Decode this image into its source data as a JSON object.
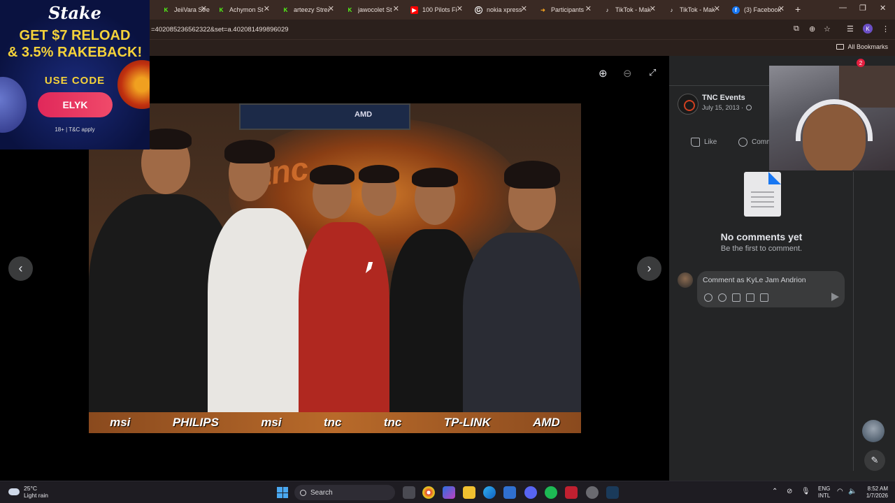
{
  "browser": {
    "tabs": [
      {
        "label": "JeiiVara Strea",
        "icon": "kick-icon",
        "color": "#53fc18"
      },
      {
        "label": "Achymon St",
        "icon": "kick-icon",
        "color": "#53fc18"
      },
      {
        "label": "arteezy Strea",
        "icon": "kick-icon",
        "color": "#53fc18"
      },
      {
        "label": "jawocolet St",
        "icon": "kick-icon",
        "color": "#53fc18"
      },
      {
        "label": "100 Pilots Fi",
        "icon": "youtube-icon",
        "color": "#ff0000"
      },
      {
        "label": "nokia xpress",
        "icon": "google-icon",
        "color": "#ffffff"
      },
      {
        "label": "Participants",
        "icon": "arrow-icon",
        "color": "#f0a020"
      },
      {
        "label": "TikTok - Mak",
        "icon": "tiktok-icon",
        "color": "#ffffff"
      },
      {
        "label": "TikTok - Mak",
        "icon": "tiktok-icon",
        "color": "#ffffff"
      },
      {
        "label": "(3) Facebook",
        "icon": "facebook-icon",
        "color": "#1877f2"
      }
    ],
    "url": "=402085236562322&set=a.402081499896029",
    "profile_initial": "K",
    "bookmarks_label": "All Bookmarks"
  },
  "ad": {
    "brand": "Stake",
    "headline_1": "GET $7 RELOAD",
    "headline_2": "& 3.5% RAKEBACK!",
    "use_code": "USE CODE",
    "code": "ELYK",
    "disclaimer": "18+ | T&C apply"
  },
  "photo": {
    "top_logo": "AMD",
    "bg_text": "tnc",
    "banner": [
      "msi",
      "PHILIPS",
      "msi",
      "tnc",
      "tnc",
      "TP-LINK",
      "AMD"
    ]
  },
  "post": {
    "page_name": "TNC Events",
    "date": "July 15, 2013 ·",
    "like_label": "Like",
    "comment_label": "Comm",
    "no_comments_title": "No comments yet",
    "no_comments_sub": "Be the first to comment.",
    "comment_placeholder": "Comment as KyLe Jam Andrion",
    "notification_count": "2"
  },
  "taskbar": {
    "temperature": "25°C",
    "weather": "Light rain",
    "search_label": "Search",
    "lang_1": "ENG",
    "lang_2": "INTL",
    "time": "8:52 AM",
    "date": "1/7/2026"
  }
}
